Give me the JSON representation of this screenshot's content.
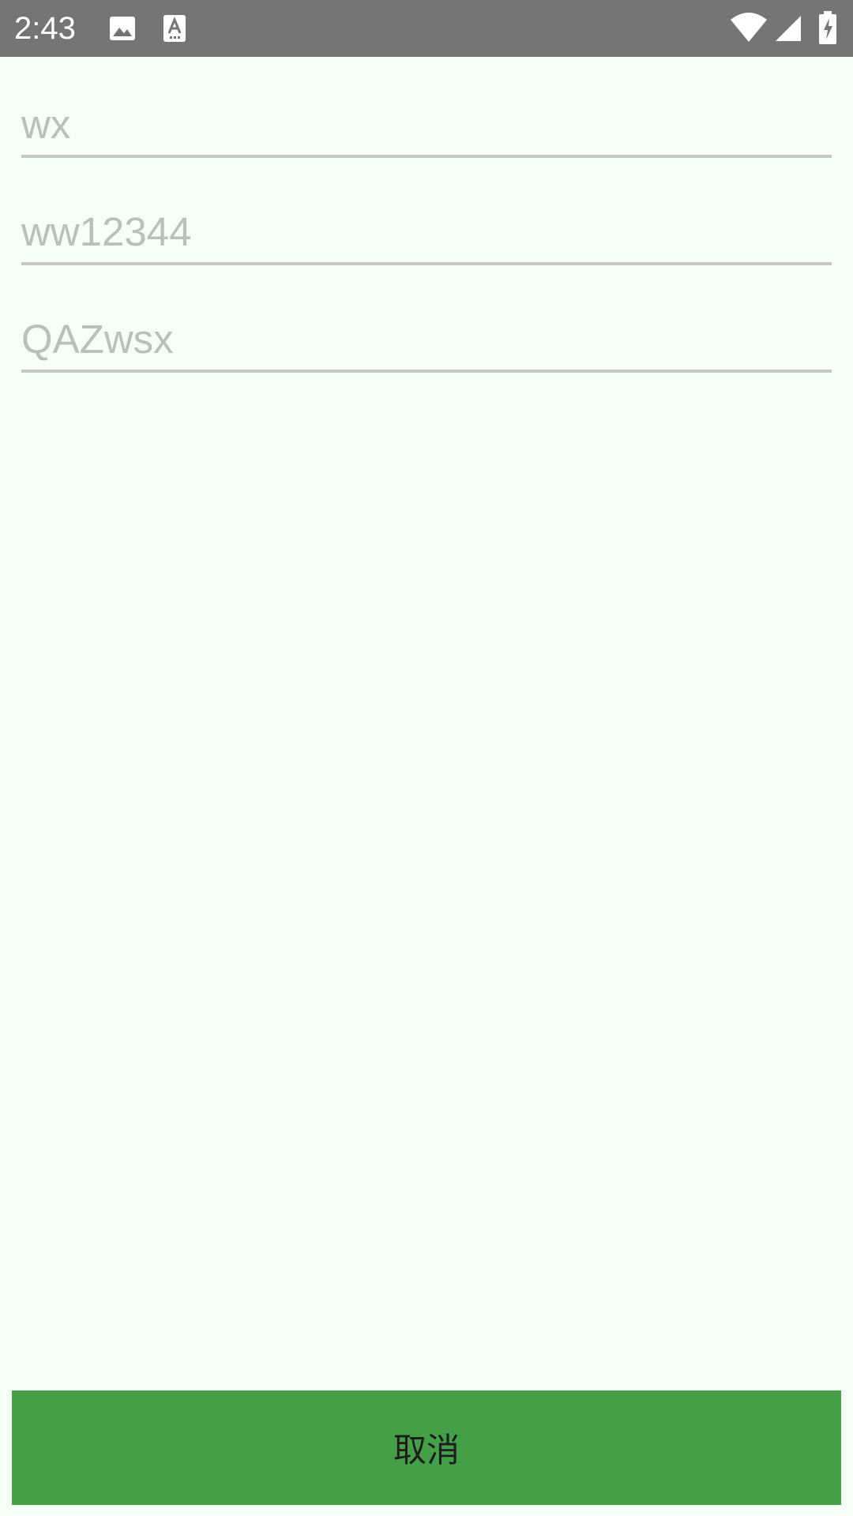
{
  "status_bar": {
    "time": "2:43",
    "notification_icons": [
      "image-icon",
      "text-input-icon"
    ],
    "system_icons": [
      "wifi-icon",
      "cellular-signal-icon",
      "battery-charging-icon"
    ]
  },
  "form": {
    "fields": [
      {
        "value": "",
        "placeholder": "wx"
      },
      {
        "value": "",
        "placeholder": "ww12344"
      },
      {
        "value": "",
        "placeholder": "QAZwsx"
      }
    ]
  },
  "actions": {
    "cancel_label": "取消"
  },
  "colors": {
    "background": "#f5fff5",
    "status_bar": "#757575",
    "button": "#43a047",
    "underline": "#c4c9c4",
    "placeholder": "#b9bfb9"
  }
}
